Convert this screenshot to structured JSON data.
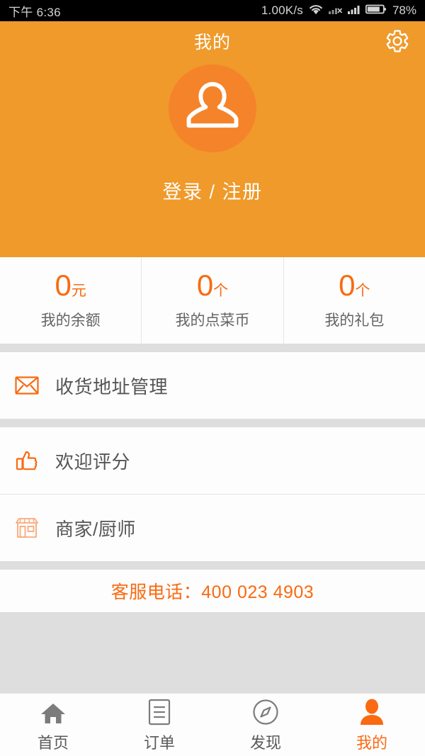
{
  "statusbar": {
    "time": "下午 6:36",
    "netspeed": "1.00K/s",
    "battery_pct": "78%",
    "icons": [
      "wifi-icon",
      "signal-no-sim-icon",
      "signal-bars-icon",
      "battery-icon"
    ]
  },
  "header": {
    "title": "我的",
    "settings_icon": "gear-icon",
    "avatar_icon": "person-placeholder-icon",
    "login_label": "登录 / 注册",
    "bg_color": "#ef9a2b",
    "avatar_color": "#f5832a"
  },
  "stats": [
    {
      "value": "0",
      "unit": "元",
      "label": "我的余额"
    },
    {
      "value": "0",
      "unit": "个",
      "label": "我的点菜币"
    },
    {
      "value": "0",
      "unit": "个",
      "label": "我的礼包"
    }
  ],
  "menu": [
    {
      "icon": "envelope-icon",
      "label": "收货地址管理"
    },
    {
      "icon": "thumbs-up-icon",
      "label": "欢迎评分"
    },
    {
      "icon": "shop-icon",
      "label": "商家/厨师"
    }
  ],
  "support": {
    "phone_text": "客服电话：400 023 4903",
    "color": "#f96a12"
  },
  "tabbar": {
    "active_color": "#f96a12",
    "inactive_color": "#5a5a5a",
    "items": [
      {
        "icon": "home-icon",
        "label": "首页",
        "active": false
      },
      {
        "icon": "orders-icon",
        "label": "订单",
        "active": false
      },
      {
        "icon": "compass-icon",
        "label": "发现",
        "active": false
      },
      {
        "icon": "person-icon",
        "label": "我的",
        "active": true
      }
    ]
  }
}
